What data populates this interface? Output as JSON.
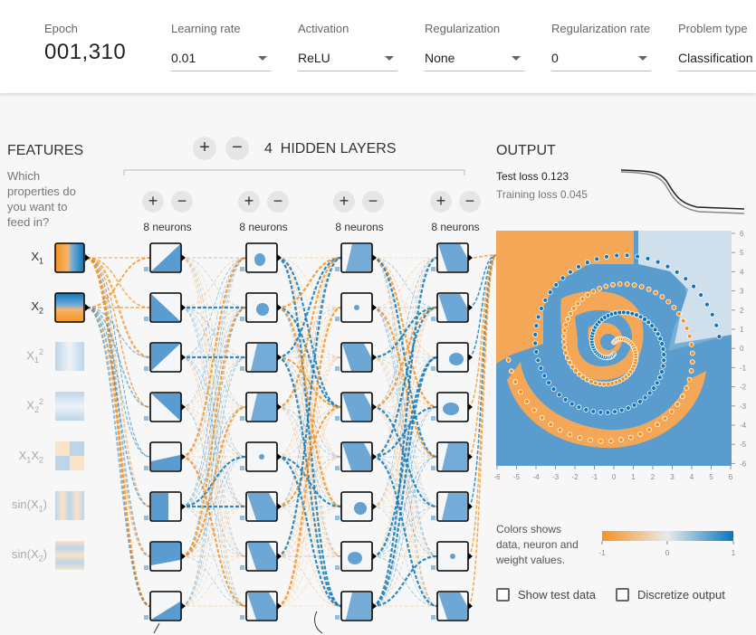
{
  "header": {
    "epoch_label": "Epoch",
    "epoch_value": "001,310",
    "controls": [
      {
        "label": "Learning rate",
        "value": "0.01"
      },
      {
        "label": "Activation",
        "value": "ReLU"
      },
      {
        "label": "Regularization",
        "value": "None"
      },
      {
        "label": "Regularization rate",
        "value": "0"
      },
      {
        "label": "Problem type",
        "value": "Classification"
      }
    ]
  },
  "features": {
    "title": "FEATURES",
    "subtitle_lines": [
      "Which",
      "properties do",
      "you want to",
      "feed in?"
    ],
    "items": [
      {
        "name": "X1",
        "active": true
      },
      {
        "name": "X2",
        "active": true
      },
      {
        "name": "X1^2",
        "active": false
      },
      {
        "name": "X2^2",
        "active": false
      },
      {
        "name": "X1X2",
        "active": false
      },
      {
        "name": "sin(X1)",
        "active": false
      },
      {
        "name": "sin(X2)",
        "active": false
      }
    ]
  },
  "network": {
    "add_symbol": "+",
    "remove_symbol": "−",
    "layer_count": "4",
    "hidden_layers_label": "HIDDEN LAYERS",
    "layers": [
      {
        "neurons_label": "8 neurons"
      },
      {
        "neurons_label": "8 neurons"
      },
      {
        "neurons_label": "8 neurons"
      },
      {
        "neurons_label": "8 neurons"
      }
    ]
  },
  "output": {
    "title": "OUTPUT",
    "test_loss": "Test loss 0.123",
    "training_loss": "Training loss 0.045",
    "y_ticks": [
      "6",
      "5",
      "4",
      "3",
      "2",
      "1",
      "0",
      "-1",
      "-2",
      "-3",
      "-4",
      "-5",
      "-6"
    ],
    "x_ticks": [
      "-6",
      "-5",
      "-4",
      "-3",
      "-2",
      "-1",
      "0",
      "1",
      "2",
      "3",
      "4",
      "5",
      "6"
    ],
    "legend_lines": [
      "Colors shows",
      "data, neuron and",
      "weight values."
    ],
    "scale_ticks": [
      "-1",
      "0",
      "1"
    ],
    "show_test_data": "Show test data",
    "discretize_output": "Discretize output"
  },
  "colors": {
    "orange": "#f59322",
    "blue": "#0877bd",
    "light_orange": "#f7c28c",
    "light_blue": "#c6dbea"
  }
}
